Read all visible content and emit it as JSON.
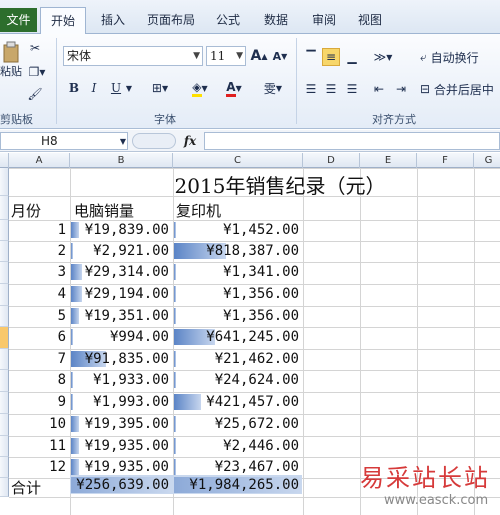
{
  "ribbon": {
    "tabs": [
      "文件",
      "开始",
      "插入",
      "页面布局",
      "公式",
      "数据",
      "审阅",
      "视图"
    ],
    "font_name": "宋体",
    "font_size": "11",
    "group_labels": {
      "clipboard": "剪贴板",
      "font": "字体",
      "alignment": "对齐方式"
    },
    "clipboard_paste": "粘贴",
    "wrap_text": "自动换行",
    "merge_center": "合并后居中",
    "bold": "B",
    "italic": "I",
    "underline": "U",
    "grow_font": "A",
    "shrink_font": "A",
    "font_color": "A",
    "phonetic": "雯"
  },
  "formula_bar": {
    "name_box": "H8",
    "fx": "fx",
    "formula": ""
  },
  "columns": [
    "A",
    "B",
    "C",
    "D",
    "E",
    "F",
    "G"
  ],
  "sheet": {
    "title": "2015年销售纪录（元）",
    "headers": [
      "月份",
      "电脑销量",
      "复印机"
    ],
    "rows": [
      {
        "month": "1",
        "computer": "¥19,839.00",
        "copier": "¥1,452.00"
      },
      {
        "month": "2",
        "computer": "¥2,921.00",
        "copier": "¥818,387.00"
      },
      {
        "month": "3",
        "computer": "¥29,314.00",
        "copier": "¥1,341.00"
      },
      {
        "month": "4",
        "computer": "¥29,194.00",
        "copier": "¥1,356.00"
      },
      {
        "month": "5",
        "computer": "¥19,351.00",
        "copier": "¥1,356.00"
      },
      {
        "month": "6",
        "computer": "¥994.00",
        "copier": "¥641,245.00"
      },
      {
        "month": "7",
        "computer": "¥91,835.00",
        "copier": "¥21,462.00"
      },
      {
        "month": "8",
        "computer": "¥1,933.00",
        "copier": "¥24,624.00"
      },
      {
        "month": "9",
        "computer": "¥1,993.00",
        "copier": "¥421,457.00"
      },
      {
        "month": "10",
        "computer": "¥19,395.00",
        "copier": "¥25,672.00"
      },
      {
        "month": "11",
        "computer": "¥19,935.00",
        "copier": "¥2,446.00"
      },
      {
        "month": "12",
        "computer": "¥19,935.00",
        "copier": "¥23,467.00"
      }
    ],
    "total": {
      "label": "合计",
      "computer": "¥256,639.00",
      "copier": "¥1,984,265.00"
    }
  },
  "databars": {
    "computer_fill": [
      0.08,
      0.01,
      0.11,
      0.11,
      0.08,
      0.0,
      0.36,
      0.01,
      0.01,
      0.08,
      0.08,
      0.08,
      1.0
    ],
    "copier_fill": [
      0.0,
      0.41,
      0.0,
      0.0,
      0.0,
      0.32,
      0.01,
      0.01,
      0.21,
      0.01,
      0.0,
      0.01,
      1.0
    ]
  },
  "watermark": {
    "cn": "易采站长站",
    "en": "www.easck.com"
  },
  "colors": {
    "file_tab": "#2d6e2d",
    "databar": "#5b84c6",
    "watermark": "#d63a3a"
  }
}
